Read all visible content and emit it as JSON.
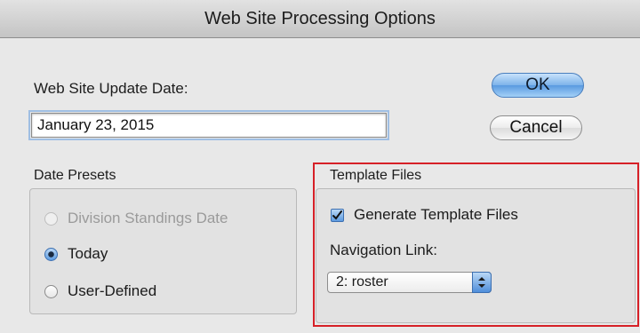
{
  "dialog": {
    "title": "Web Site Processing Options"
  },
  "update_date": {
    "label": "Web Site Update Date:",
    "value": "January 23, 2015"
  },
  "buttons": {
    "ok_label": "OK",
    "cancel_label": "Cancel"
  },
  "date_presets": {
    "title": "Date Presets",
    "options": [
      {
        "label": "Division Standings Date",
        "state": "disabled"
      },
      {
        "label": "Today",
        "state": "selected"
      },
      {
        "label": "User-Defined",
        "state": "unselected"
      }
    ]
  },
  "template_files": {
    "title": "Template Files",
    "generate_label": "Generate Template Files",
    "generate_checked": true,
    "nav_link_label": "Navigation Link:",
    "nav_link_value": "2: roster"
  },
  "colors": {
    "highlight_border": "#d62027",
    "accent_blue": "#5d9be0"
  }
}
